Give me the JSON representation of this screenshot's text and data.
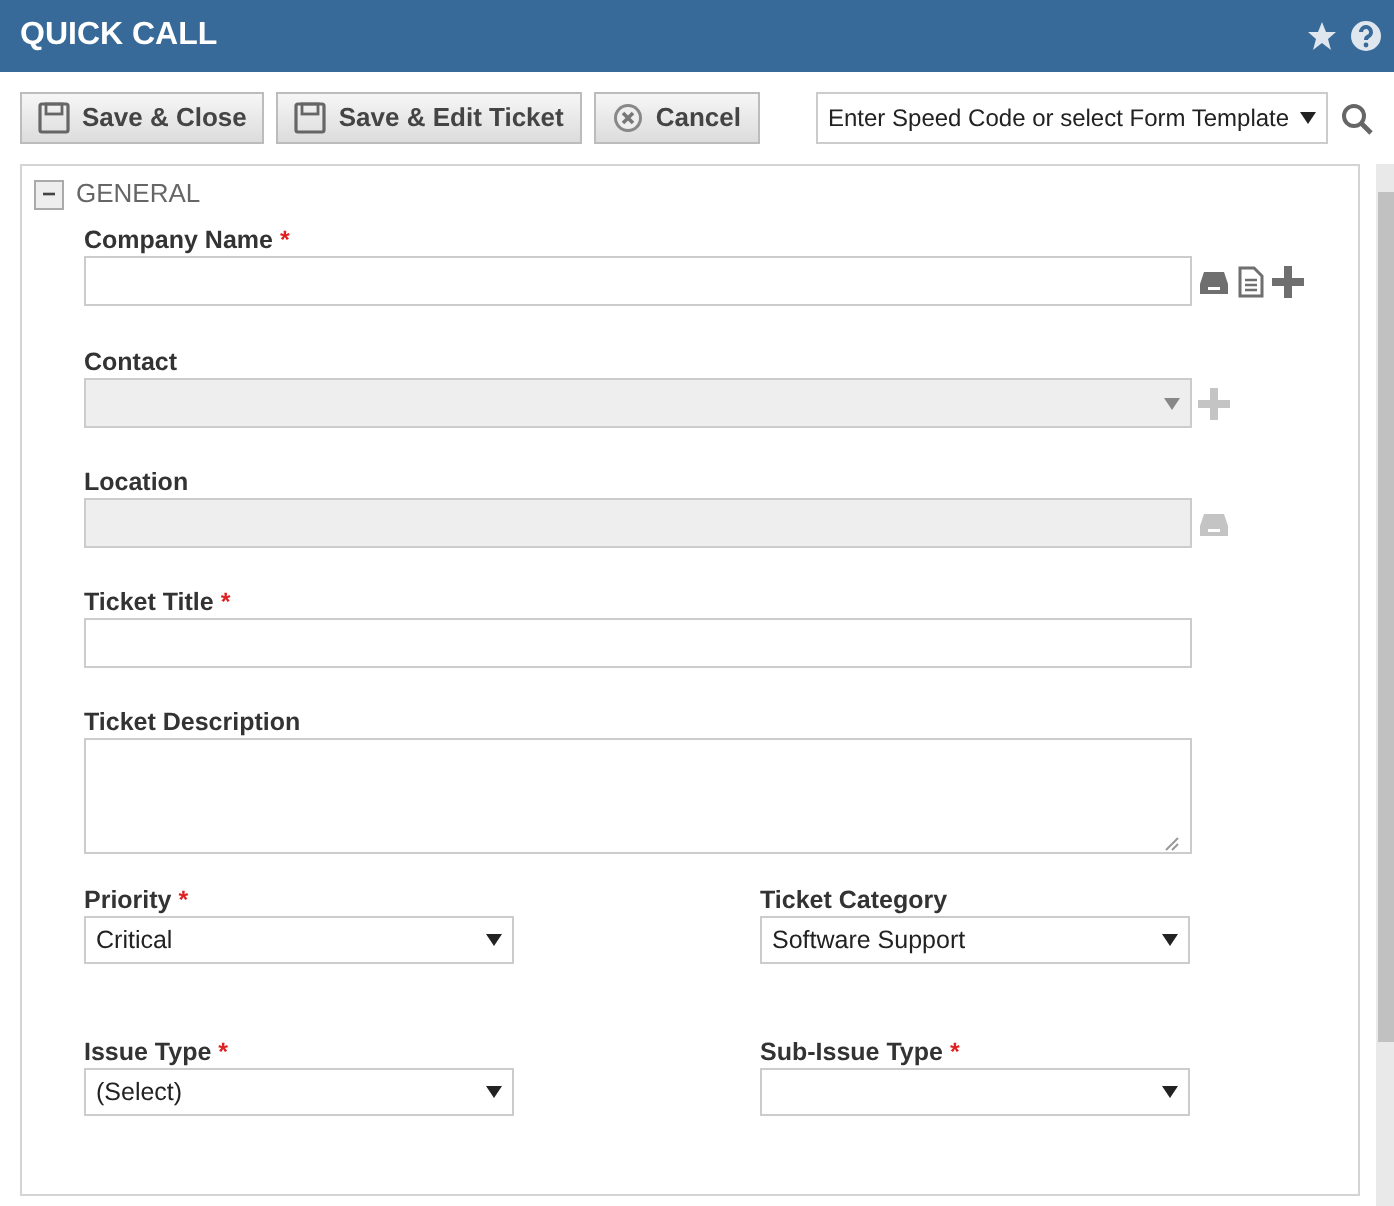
{
  "window": {
    "title": "QUICK CALL"
  },
  "header_icons": [
    {
      "kind": "star"
    },
    {
      "kind": "help"
    }
  ],
  "toolbar": {
    "buttons": [
      {
        "label": "Save & Close",
        "kind": "save"
      },
      {
        "label": "Save & Edit Ticket",
        "kind": "save"
      },
      {
        "label": "Cancel",
        "kind": "cancel"
      }
    ],
    "template_select": {
      "value": "Enter Speed Code or select Form Template"
    }
  },
  "section": {
    "title": "GENERAL",
    "expanded": true,
    "toggle": "−",
    "rows": [
      {
        "fields": [
          {
            "label": "Company Name",
            "required_mark": "*",
            "kind": "text",
            "disabled": false,
            "actions": [
              {
                "kind": "lookup",
                "disabled": false
              },
              {
                "kind": "document",
                "disabled": false
              },
              {
                "kind": "add",
                "disabled": false
              }
            ]
          }
        ]
      },
      {
        "fields": [
          {
            "label": "Contact",
            "kind": "select",
            "disabled": true,
            "actions": [
              {
                "kind": "add",
                "disabled": true
              }
            ]
          }
        ]
      },
      {
        "fields": [
          {
            "label": "Location",
            "kind": "text",
            "disabled": true,
            "actions": [
              {
                "kind": "lookup",
                "disabled": true
              }
            ]
          }
        ]
      },
      {
        "fields": [
          {
            "label": "Ticket Title",
            "required_mark": "*",
            "kind": "text",
            "disabled": false
          }
        ]
      },
      {
        "fields": [
          {
            "label": "Ticket Description",
            "kind": "textarea",
            "disabled": false
          }
        ]
      },
      {
        "fields": [
          {
            "label": "Priority",
            "required_mark": "*",
            "kind": "select",
            "disabled": false,
            "value": "Critical"
          },
          {
            "label": "Ticket Category",
            "kind": "select",
            "disabled": false,
            "value": "Software Support"
          }
        ]
      },
      {
        "fields": [
          {
            "label": "Issue Type",
            "required_mark": "*",
            "kind": "select",
            "disabled": false,
            "value": "(Select)"
          },
          {
            "label": "Sub-Issue Type",
            "required_mark": "*",
            "kind": "select",
            "disabled": false
          }
        ]
      }
    ]
  }
}
